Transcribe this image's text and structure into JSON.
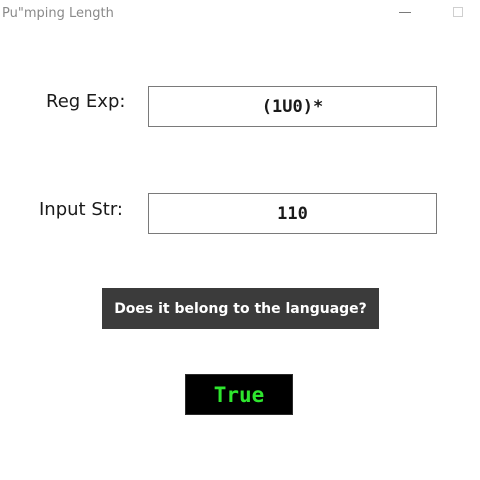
{
  "window": {
    "title": "Pu\"mping Length"
  },
  "form": {
    "regexp_label": "Reg Exp:",
    "regexp_value": "(1U0)*",
    "input_label": "Input Str:",
    "input_value": "110"
  },
  "actions": {
    "check_label": "Does it belong to the language?"
  },
  "result": {
    "text": "True",
    "color": "#2ee62e"
  }
}
